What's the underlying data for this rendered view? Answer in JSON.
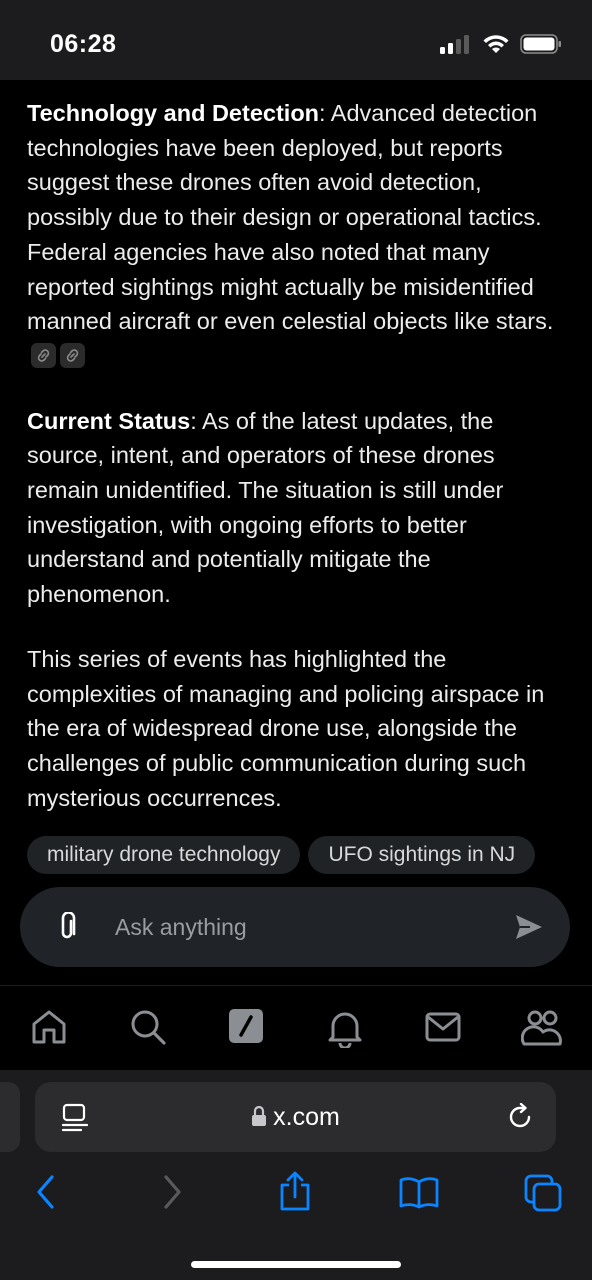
{
  "status_bar": {
    "time": "06:28"
  },
  "article": {
    "p1_heading": "Technology and Detection",
    "p1_text": ": Advanced detection technologies have been deployed, but reports suggest these drones often avoid detection, possibly due to their design or operational tactics. Federal agencies have also noted that many reported sightings might actually be misidentified manned aircraft or even celestial objects like stars.",
    "p2_heading": "Current Status",
    "p2_text": ": As of the latest updates, the source, intent, and operators of these drones remain unidentified. The situation is still under investigation, with ongoing efforts to better understand and potentially mitigate the phenomenon.",
    "p3_text": "This series of events has highlighted the complexities of managing and policing airspace in the era of widespread drone use, alongside the challenges of public communication during such mysterious occurrences."
  },
  "suggestions": [
    "military drone technology",
    "UFO sightings in NJ"
  ],
  "composer": {
    "placeholder": "Ask anything"
  },
  "tabs": [
    "home-icon",
    "search-icon",
    "grok-icon",
    "notifications-icon",
    "messages-icon",
    "communities-icon"
  ],
  "browser": {
    "url": "x.com"
  },
  "colors": {
    "accent": "#0a84ff",
    "background": "#000000"
  }
}
